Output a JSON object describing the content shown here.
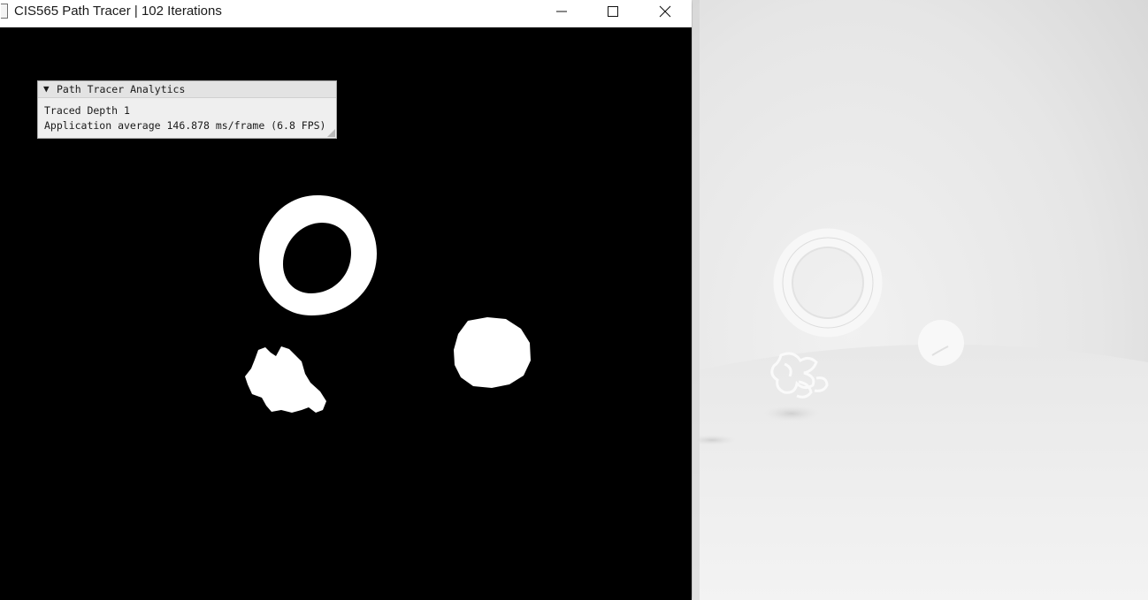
{
  "window": {
    "title": "CIS565 Path Tracer | 102 Iterations",
    "controls": {
      "minimize_icon": "minimize-icon",
      "maximize_icon": "maximize-icon",
      "close_icon": "close-icon"
    }
  },
  "analytics_panel": {
    "title": "Path Tracer Analytics",
    "collapse_arrow": "▼",
    "traced_depth": "Traced Depth 1",
    "app_average": "Application average 146.878 ms/frame (6.8 FPS)"
  },
  "colors": {
    "viewport_background": "#000000",
    "scene_objects": "#ffffff",
    "render_background": "#e6e6e6"
  }
}
